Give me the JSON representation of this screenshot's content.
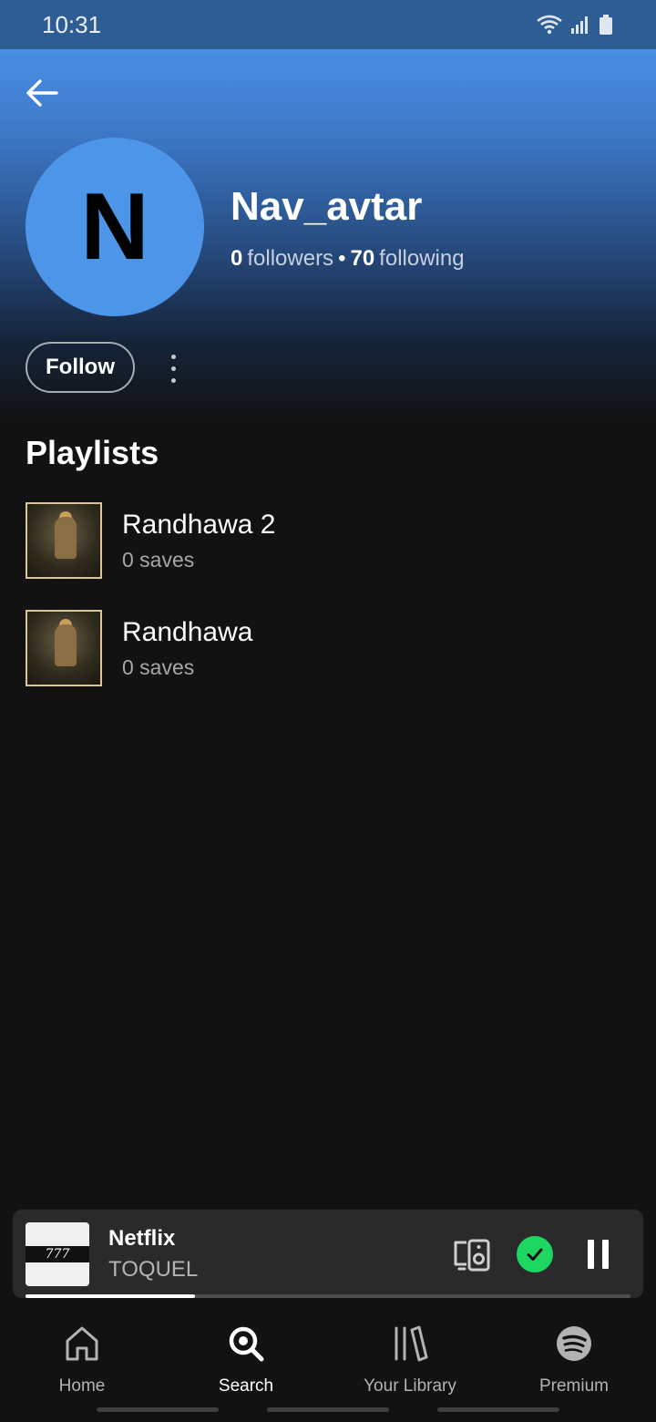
{
  "status_bar": {
    "time": "10:31",
    "icons": [
      "wifi-icon",
      "signal-icon",
      "battery-icon"
    ]
  },
  "header": {
    "back_icon": "arrow-left-icon",
    "accent": "#4a8fe6"
  },
  "profile": {
    "initial": "N",
    "name": "Nav_avtar",
    "followers_count": "0",
    "followers_label": "followers",
    "following_count": "70",
    "following_label": "following",
    "avatar_color": "#4c95e8"
  },
  "actions": {
    "follow_label": "Follow",
    "more_icon": "more-vertical-icon"
  },
  "playlists": {
    "title": "Playlists",
    "items": [
      {
        "title": "Randhawa 2",
        "subtitle": "0 saves"
      },
      {
        "title": "Randhawa",
        "subtitle": "0 saves"
      }
    ]
  },
  "now_playing": {
    "title": "Netflix",
    "artist": "TOQUEL",
    "art_text": "777",
    "progress": 0.28,
    "liked_color": "#1ed760"
  },
  "nav": {
    "items": [
      {
        "label": "Home",
        "icon": "home-icon"
      },
      {
        "label": "Search",
        "icon": "search-icon"
      },
      {
        "label": "Your Library",
        "icon": "library-icon"
      },
      {
        "label": "Premium",
        "icon": "spotify-icon"
      }
    ],
    "active": "Search"
  }
}
